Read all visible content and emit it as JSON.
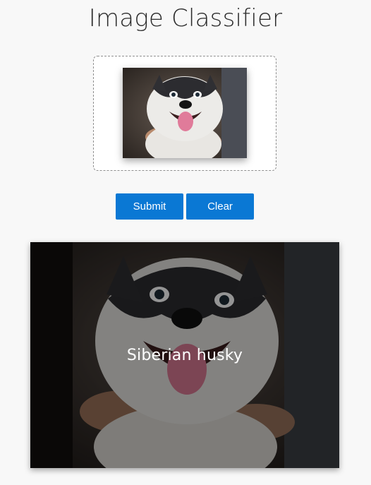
{
  "header": {
    "title": "Image Classifier"
  },
  "upload": {
    "thumbnail_subject": "husky-dog-photo"
  },
  "actions": {
    "submit_label": "Submit",
    "clear_label": "Clear"
  },
  "result": {
    "label": "Siberian husky"
  },
  "colors": {
    "accent": "#0a78d4",
    "background": "#f8f8f8"
  }
}
